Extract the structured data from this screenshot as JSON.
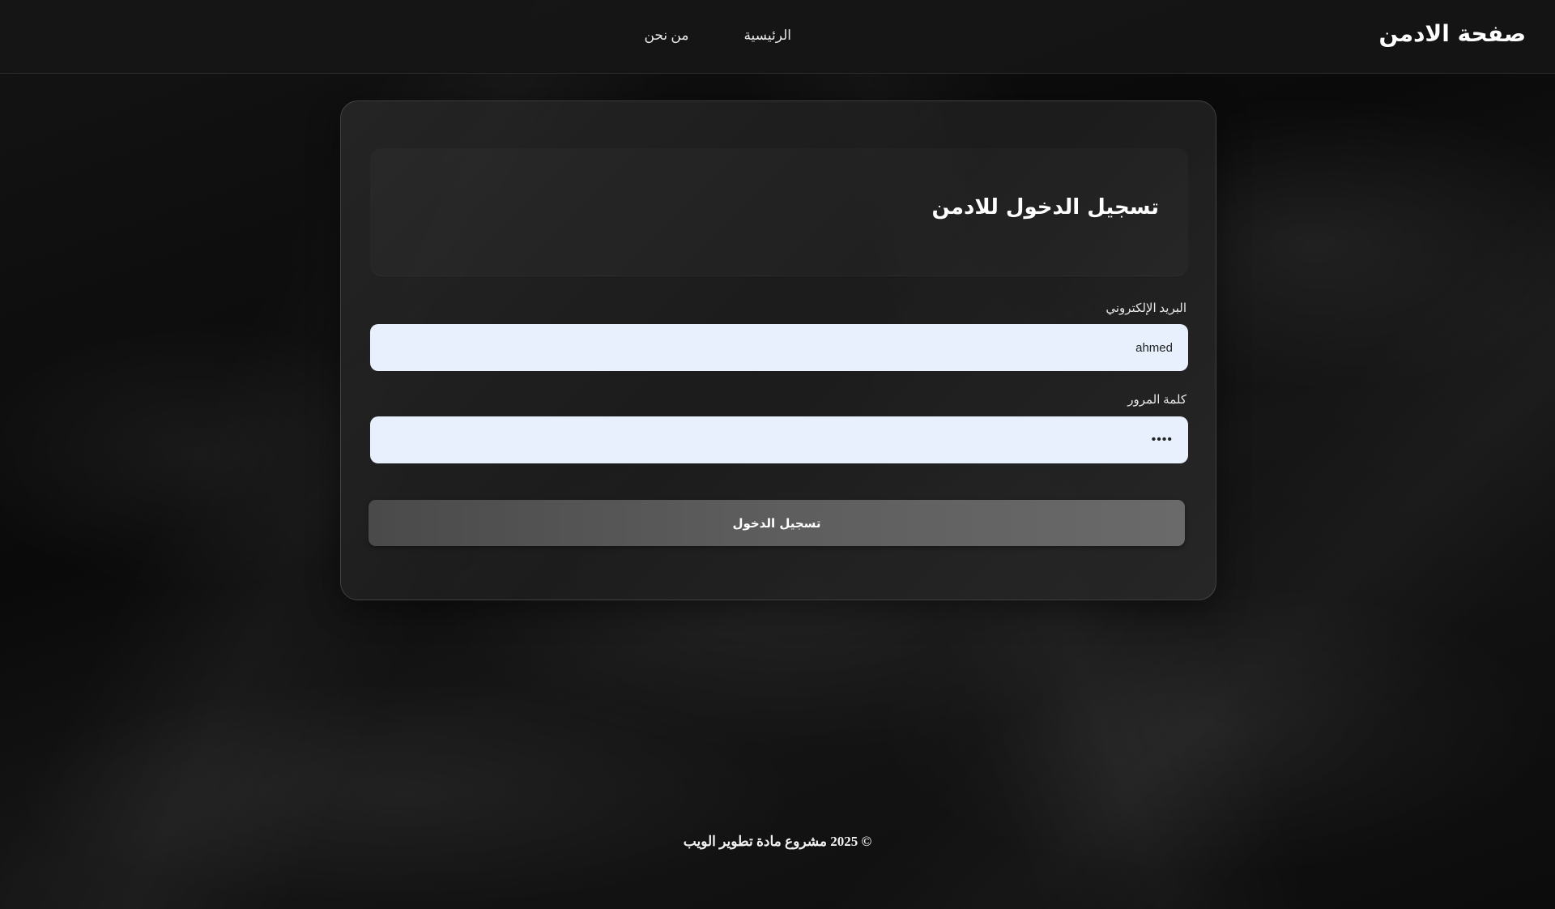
{
  "header": {
    "brand": "صفحة الادمن",
    "nav": [
      {
        "label": "الرئيسية"
      },
      {
        "label": "من نحن"
      }
    ]
  },
  "login": {
    "title": "تسجيل الدخول للادمن",
    "email": {
      "label": "البريد الإلكتروني",
      "value": "ahmed"
    },
    "password": {
      "label": "كلمة المرور",
      "value": "••••"
    },
    "submit_label": "تسجيل الدخول"
  },
  "footer": {
    "text": "© 2025 مشروع مادة تطوير الويب"
  },
  "colors": {
    "input_background": "#e8f0fe",
    "button_background": "#5c5c5c",
    "page_background": "#0b0b0b"
  }
}
